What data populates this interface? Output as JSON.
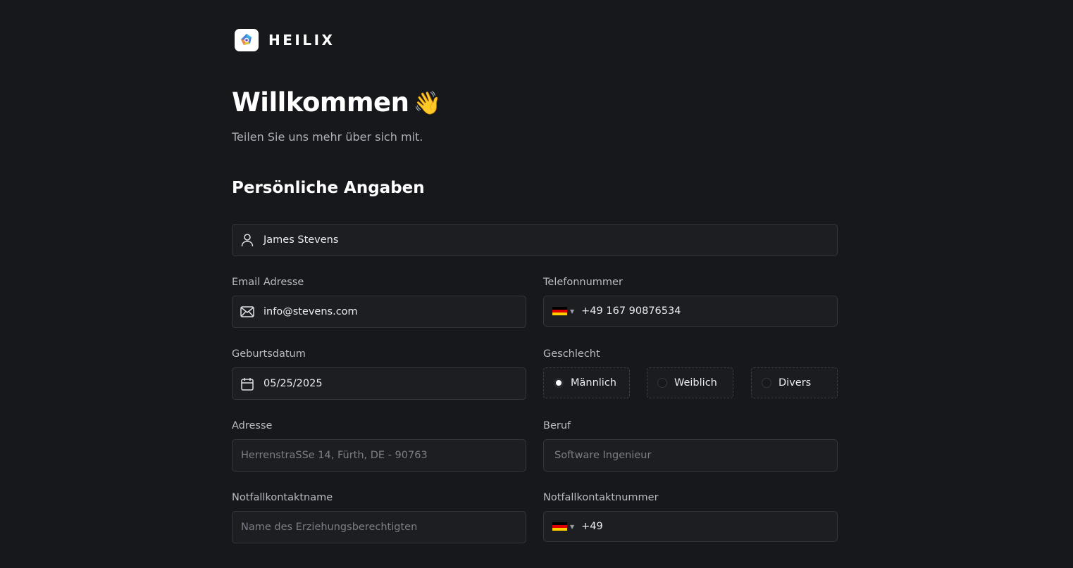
{
  "brand": {
    "name": "HEILIX"
  },
  "header": {
    "title": "Willkommen",
    "emoji": "👋",
    "subtitle": "Teilen Sie uns mehr über sich mit."
  },
  "section": {
    "title": "Persönliche Angaben"
  },
  "form": {
    "name": {
      "value": "James Stevens"
    },
    "email": {
      "label": "Email Adresse",
      "value": "info@stevens.com"
    },
    "phone": {
      "label": "Telefonnummer",
      "value": "+49 167 90876534",
      "country": "DE"
    },
    "birthdate": {
      "label": "Geburtsdatum",
      "value": "05/25/2025"
    },
    "gender": {
      "label": "Geschlecht",
      "options": [
        "Männlich",
        "Weiblich",
        "Divers"
      ],
      "selected": "Männlich"
    },
    "address": {
      "label": "Adresse",
      "placeholder": "HerrenstraSSe 14, Fürth, DE - 90763"
    },
    "job": {
      "label": "Beruf",
      "placeholder": "Software Ingenieur"
    },
    "emergency_name": {
      "label": "Notfallkontaktname",
      "placeholder": "Name des Erziehungsberechtigten"
    },
    "emergency_phone": {
      "label": "Notfallkontaktnummer",
      "value": "+49",
      "country": "DE"
    }
  },
  "colors": {
    "background": "#17181c",
    "field": "#1d1e22",
    "border": "#34363c"
  },
  "icons": [
    "user-icon",
    "mail-icon",
    "calendar-icon",
    "germany-flag-icon",
    "chevron-down-icon"
  ]
}
